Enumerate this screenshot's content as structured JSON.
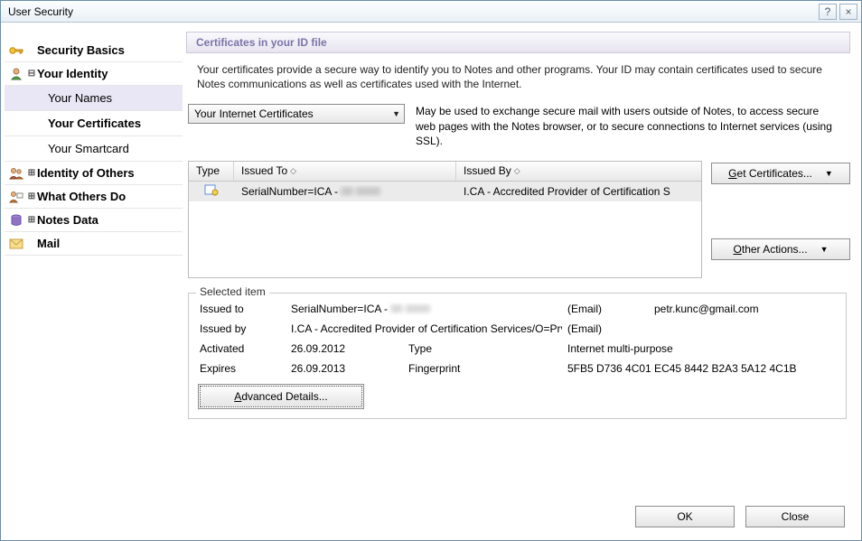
{
  "window": {
    "title": "User Security",
    "help": "?",
    "close": "×"
  },
  "sidebar": {
    "basics": "Security Basics",
    "identity": "Your Identity",
    "names": "Your Names",
    "certs": "Your Certificates",
    "smartcard": "Your Smartcard",
    "others": "Identity of Others",
    "whatothers": "What Others Do",
    "notesdata": "Notes Data",
    "mail": "Mail"
  },
  "panel": {
    "title": "Certificates in your ID file",
    "desc": "Your certificates provide a secure way to identify you to Notes and other programs. Your ID may contain certificates used to secure Notes communications as well as certificates used with the Internet."
  },
  "dropdown": {
    "selected": "Your Internet Certificates",
    "desc": "May be used to exchange secure mail with users outside of Notes, to access secure web pages with the Notes browser, or to secure connections to Internet services (using SSL)."
  },
  "table": {
    "col_type": "Type",
    "col_issuedto": "Issued To",
    "col_issuedby": "Issued By",
    "row0": {
      "issued_to_prefix": "SerialNumber=ICA - ",
      "issued_to_blur": "00 0000",
      "issued_by": "I.CA - Accredited Provider of Certification S"
    }
  },
  "buttons": {
    "getcerts_pre": "G",
    "getcerts_rest": "et Certificates...",
    "otheractions_pre": "O",
    "otheractions_rest": "ther Actions...",
    "advanced_pre": "A",
    "advanced_rest": "dvanced Details...",
    "ok": "OK",
    "close": "Close"
  },
  "selected": {
    "legend": "Selected item",
    "lbl_issued_to": "Issued to",
    "val_issued_to_prefix": "SerialNumber=ICA - ",
    "val_issued_to_blur": "00 0000",
    "lbl_email1": "(Email)",
    "val_email1": "petr.kunc@gmail.com",
    "lbl_issued_by": "Issued by",
    "val_issued_by": "I.CA - Accredited Provider of Certification Services/O=Prv",
    "lbl_email2": "(Email)",
    "val_email2": "",
    "lbl_activated": "Activated",
    "val_activated": "26.09.2012",
    "lbl_type": "Type",
    "val_type": "Internet multi-purpose",
    "lbl_expires": "Expires",
    "val_expires": "26.09.2013",
    "lbl_fingerprint": "Fingerprint",
    "val_fingerprint": "5FB5 D736 4C01 EC45 8442 B2A3 5A12 4C1B"
  }
}
